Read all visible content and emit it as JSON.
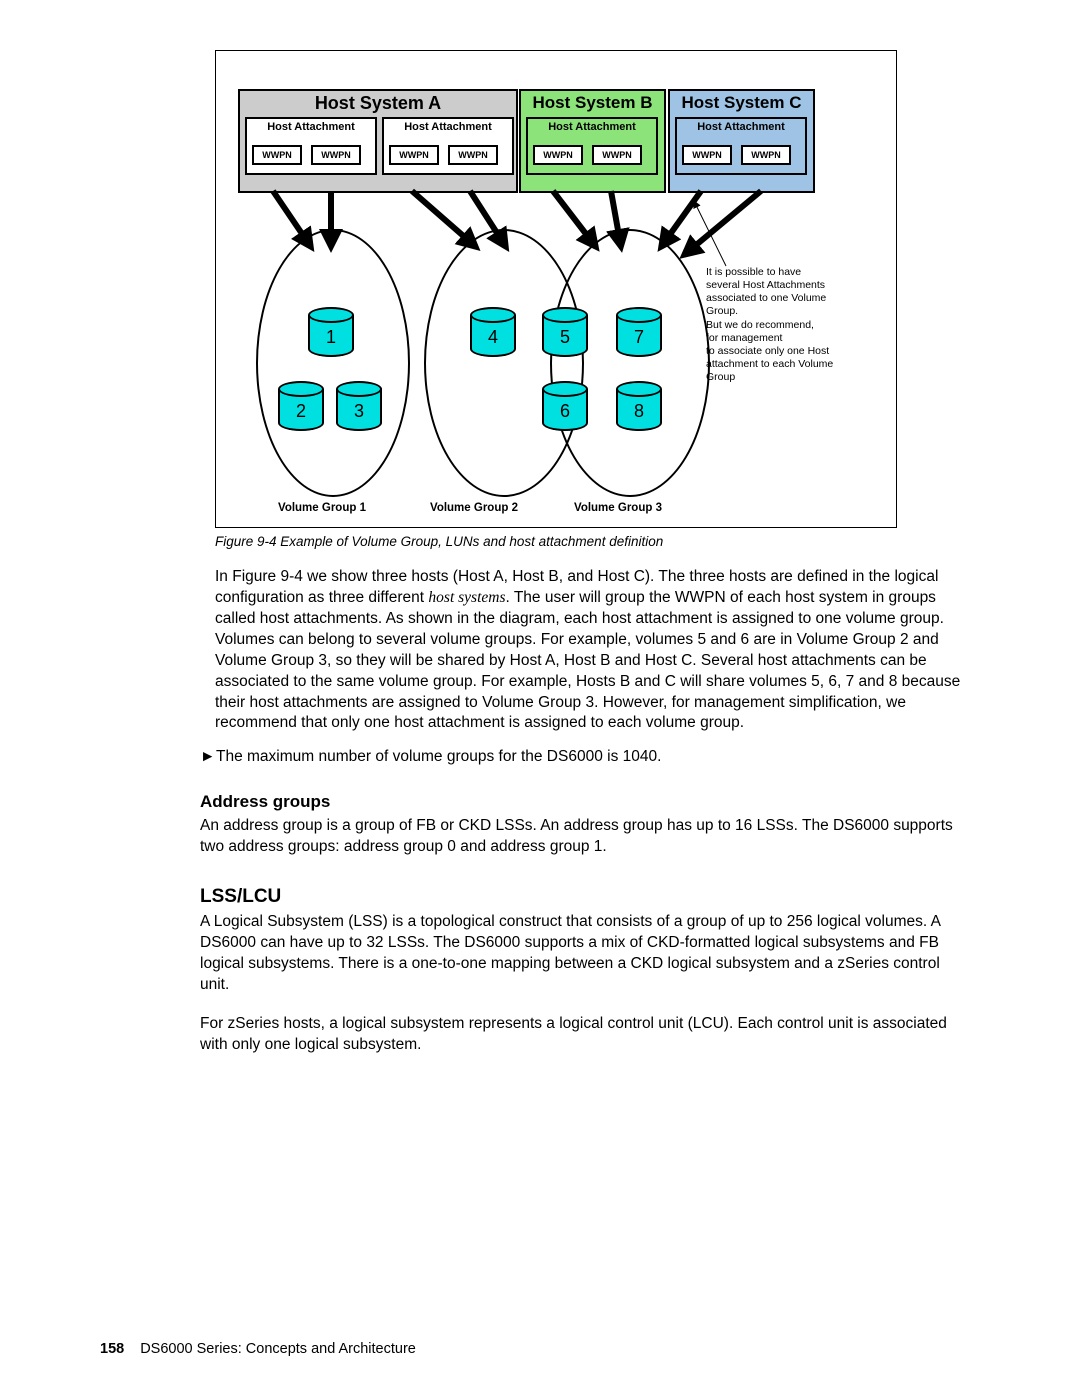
{
  "figure": {
    "caption": "Figure 9-4   Example of Volume Group, LUNs and host attachment definition",
    "host_a_title": "Host System A",
    "host_b_title": "Host System B",
    "host_c_title": "Host System C",
    "attach_label": "Host Attachment",
    "wwpn_label": "WWPN",
    "vg1_label": "Volume Group 1",
    "vg2_label": "Volume Group 2",
    "vg3_label": "Volume Group 3",
    "cylinders": {
      "c1": "1",
      "c2": "2",
      "c3": "3",
      "c4": "4",
      "c5": "5",
      "c6": "6",
      "c7": "7",
      "c8": "8"
    },
    "note_line1": "It is possible to have",
    "note_line2": "several Host Attachments",
    "note_line3": "associated to one Volume",
    "note_line4": "Group.",
    "note_line5": "But we do recommend,",
    "note_line6": "for management",
    "note_line7": "to associate only one Host",
    "note_line8": "attachment to each Volume",
    "note_line9": " Group"
  },
  "paragraphs": {
    "p1": "In Figure 9-4 we show three hosts (Host A, Host B, and Host C). The three hosts are defined in the logical configuration as three different ",
    "p1_italic": "host systems",
    "p1_rest": ". The user will group the WWPN of each host system in groups called host attachments. As shown in the diagram, each host attachment is assigned to one volume group. Volumes can belong to several volume groups. For example, volumes 5 and 6 are in Volume Group 2 and Volume Group 3, so they will be shared by Host A, Host B and Host C. Several host attachments can be associated to the same volume group. For example, Hosts B and C will share volumes 5, 6, 7 and 8 because their host attachments are assigned to Volume Group 3. However, for management simplification, we recommend that only one host attachment is assigned to each volume group.",
    "bullet1": "The maximum number of volume groups for the DS6000 is 1040.",
    "heading1": "Address groups",
    "p2": "An address group is a group of FB or CKD LSSs. An address group has up to 16 LSSs. The DS6000 supports two address groups: address group 0 and address group 1.",
    "heading2": "LSS/LCU",
    "p3": "A Logical Subsystem (LSS) is a topological construct that consists of a group of up to 256 logical volumes. A DS6000 can have up to 32 LSSs. The DS6000 supports a mix of CKD-formatted logical subsystems and FB logical subsystems. There is a one-to-one mapping between a CKD logical subsystem and a zSeries control unit.",
    "p4": "For zSeries hosts, a logical subsystem represents a logical control unit (LCU). Each control unit is associated with only one logical subsystem."
  },
  "footer": {
    "page": "158",
    "title": "DS6000 Series: Concepts and Architecture"
  }
}
